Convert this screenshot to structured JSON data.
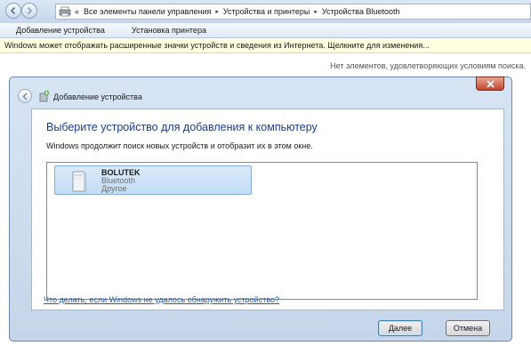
{
  "address_bar": {
    "leading": "«",
    "crumbs": [
      "Все элементы панели управления",
      "Устройства и принтеры",
      "Устройства Bluetooth"
    ],
    "separator": "▸"
  },
  "command_bar": {
    "add_device": "Добавление устройства",
    "install_printer": "Установка принтера"
  },
  "info_bar": {
    "text": "Windows может отображать расширенные значки устройств и сведения из Интернета.  Щелкните для изменения..."
  },
  "content": {
    "empty_message": "Нет элементов, удовлетворяющих условиям поиска."
  },
  "dialog": {
    "title": "Добавление устройства",
    "heading": "Выберите устройство для добавления к компьютеру",
    "subtext": "Windows продолжит поиск новых устройств и отобразит их в этом окне.",
    "devices": [
      {
        "name": "BOLUTEK",
        "type": "Bluetooth",
        "category": "Другое"
      }
    ],
    "help_link": "Что делать, если Windows не удалось обнаружить устройство?",
    "next_button": "Далее",
    "cancel_button": "Отмена"
  },
  "colors": {
    "heading": "#1e3d8f",
    "link": "#1f5fbf",
    "info_bar_bg": "#ffffe1",
    "selection": "#c1dcf3"
  }
}
